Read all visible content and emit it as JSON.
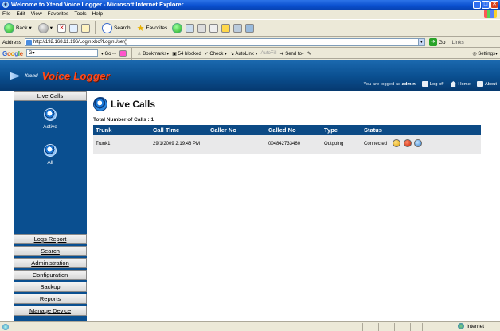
{
  "window": {
    "title": "Welcome to Xtend Voice Logger - Microsoft Internet Explorer",
    "min": "_",
    "max": "□",
    "close": "✕"
  },
  "menu": [
    "File",
    "Edit",
    "View",
    "Favorites",
    "Tools",
    "Help"
  ],
  "toolbar": {
    "back": "Back",
    "search": "Search",
    "favorites": "Favorites"
  },
  "address": {
    "label": "Address",
    "url": "http://192.168.11.196/Login.xbc?LoginUser()",
    "go": "Go",
    "links": "Links"
  },
  "googlebar": {
    "logo": [
      "G",
      "o",
      "o",
      "g",
      "l",
      "e"
    ],
    "go": "Go",
    "bookmarks": "Bookmarks",
    "blocked": "54 blocked",
    "check": "Check",
    "autolink": "AutoLink",
    "autofill": "AutoFill",
    "sendto": "Send to",
    "settings": "Settings"
  },
  "header": {
    "brand_small": "Xtend",
    "brand": "Voice Logger",
    "logged_prefix": "You are logged as",
    "user": "admin",
    "logoff": "Log off",
    "home": "Home",
    "about": "About"
  },
  "sidebar": {
    "live_calls": "Live Calls",
    "modes": [
      "Active",
      "All"
    ],
    "items": [
      "Logs Report",
      "Search",
      "Administration",
      "Configuration",
      "Backup",
      "Reports",
      "Manage Device"
    ]
  },
  "main": {
    "title": "Live Calls",
    "total_label": "Total Number of Calls :",
    "total_value": "1",
    "columns": [
      "Trunk",
      "Call Time",
      "Caller No",
      "Called No",
      "Type",
      "Status"
    ],
    "rows": [
      {
        "trunk": "Trunk1",
        "call_time": "29/1/2009 2:19:46 PM",
        "caller_no": "",
        "called_no": "004842733460",
        "type": "Outgoing",
        "status": "Connected"
      }
    ]
  },
  "statusbar": {
    "zone": "Internet"
  }
}
